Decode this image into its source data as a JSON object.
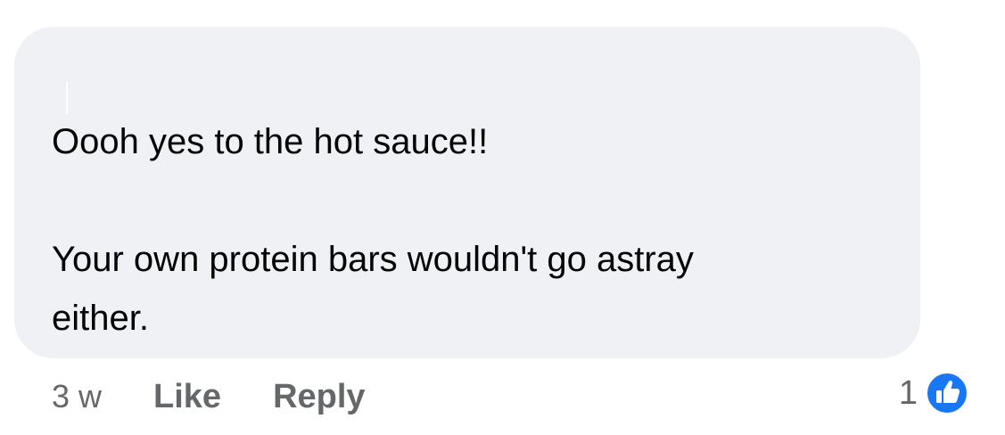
{
  "comment": {
    "text_line_1": "Oooh yes to the hot sauce!!",
    "text_line_2": "Your own protein bars wouldn't go astray",
    "text_line_3": "either."
  },
  "actions": {
    "timestamp": "3 w",
    "like_label": "Like",
    "reply_label": "Reply"
  },
  "reactions": {
    "count": "1",
    "icon": "like-reaction-icon",
    "icon_color": "#1877f2"
  },
  "colors": {
    "bubble_background": "#f0f1f4",
    "text": "#050505",
    "secondary_text": "#65676b"
  }
}
